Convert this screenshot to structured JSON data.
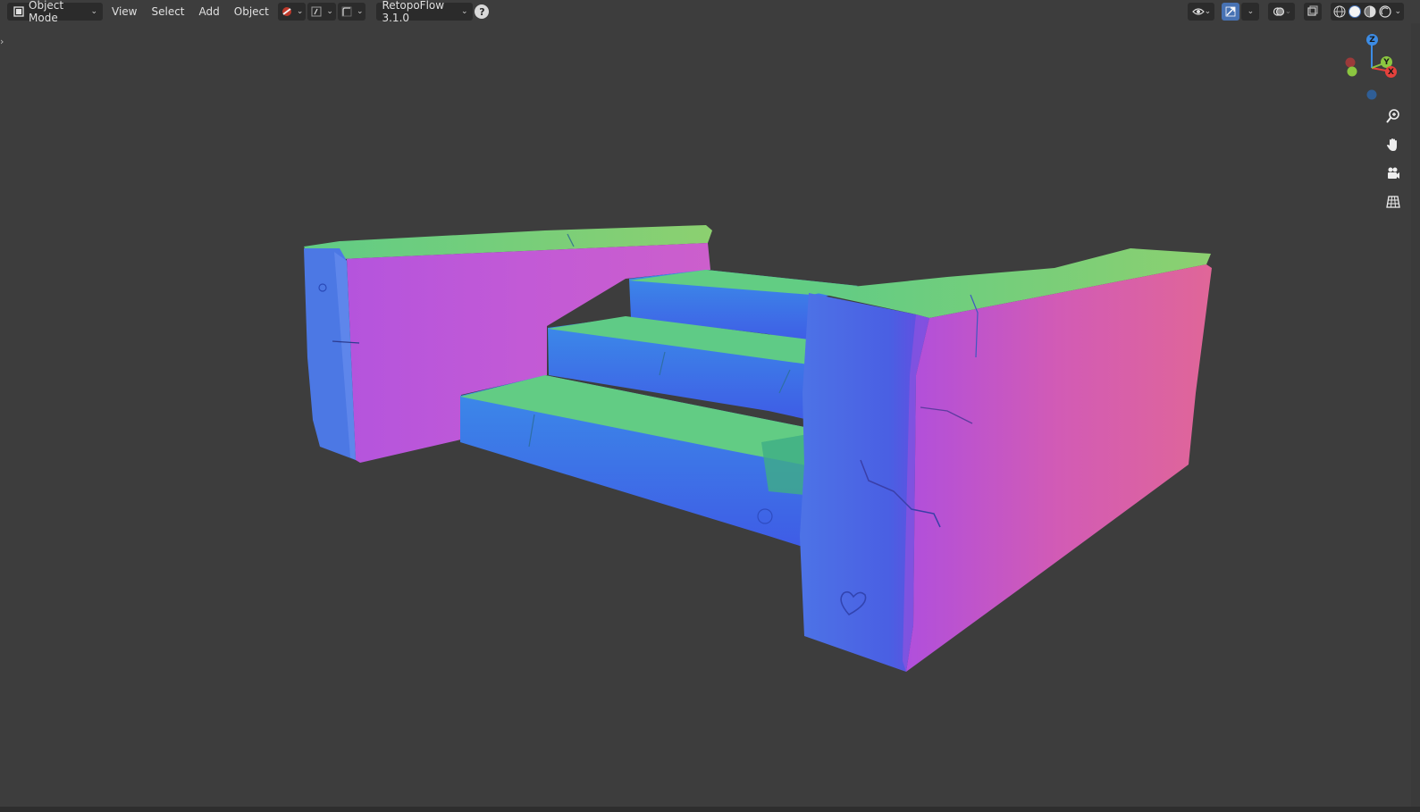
{
  "header": {
    "mode_label": "Object Mode",
    "menus": [
      "View",
      "Select",
      "Add",
      "Object"
    ],
    "addon_label": "RetopoFlow 3.1.0",
    "help_icon": "question-circle-icon"
  },
  "gizmo": {
    "z_label": "Z",
    "y_label": "Y",
    "x_label": "X",
    "x_color": "#e5413c",
    "y_color": "#8bc640",
    "z_color": "#3c8ce5"
  },
  "nav_tools": [
    "zoom-icon",
    "pan-hand-icon",
    "camera-icon",
    "grid-ortho-icon"
  ],
  "viewport": {
    "background": "#3d3d3d",
    "object": "stone-stairs-normal-map-mesh"
  }
}
